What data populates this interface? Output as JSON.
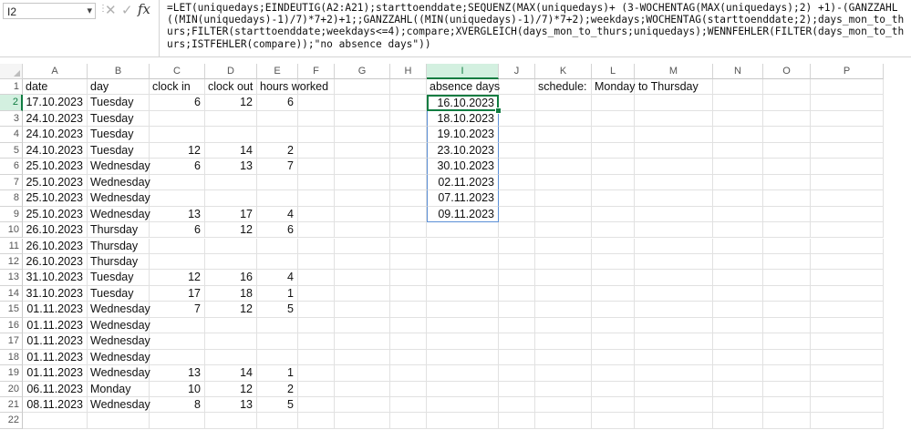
{
  "name_box": {
    "value": "I2",
    "dropdown_icon": "chevron-down-icon"
  },
  "formula_bar": {
    "cancel_icon": "x-icon",
    "enter_icon": "check-icon",
    "fx_label": "fx",
    "formula": "=LET(uniquedays;EINDEUTIG(A2:A21);starttoenddate;SEQUENZ(MAX(uniquedays)+ (3-WOCHENTAG(MAX(uniquedays);2) +1)-(GANZZAHL((MIN(uniquedays)-1)/7)*7+2)+1;;GANZZAHL((MIN(uniquedays)-1)/7)*7+2);weekdays;WOCHENTAG(starttoenddate;2);days_mon_to_thurs;FILTER(starttoenddate;weekdays<=4);compare;XVERGLEICH(days_mon_to_thurs;uniquedays);WENNFEHLER(FILTER(days_mon_to_thurs;ISTFEHLER(compare));\"no absence days\"))"
  },
  "columns": [
    "A",
    "B",
    "C",
    "D",
    "E",
    "F",
    "G",
    "H",
    "I",
    "J",
    "K",
    "L",
    "M",
    "N",
    "O",
    "P"
  ],
  "active_column": "I",
  "active_row": 2,
  "rows": [
    "1",
    "2",
    "3",
    "4",
    "5",
    "6",
    "7",
    "8",
    "9",
    "10",
    "11",
    "12",
    "13",
    "14",
    "15",
    "16",
    "17",
    "18",
    "19",
    "20",
    "21",
    "22"
  ],
  "headers": {
    "date": "date",
    "day": "day",
    "clock_in": "clock in",
    "clock_out": "clock out",
    "hours_worked": "hours worked",
    "absence_days": "absence days",
    "schedule": "schedule:",
    "schedule_value": "Monday to Thursday"
  },
  "data_rows": [
    {
      "date": "17.10.2023",
      "day": "Tuesday",
      "in": "6",
      "out": "12",
      "hours": "6"
    },
    {
      "date": "24.10.2023",
      "day": "Tuesday",
      "in": "",
      "out": "",
      "hours": ""
    },
    {
      "date": "24.10.2023",
      "day": "Tuesday",
      "in": "",
      "out": "",
      "hours": ""
    },
    {
      "date": "24.10.2023",
      "day": "Tuesday",
      "in": "12",
      "out": "14",
      "hours": "2"
    },
    {
      "date": "25.10.2023",
      "day": "Wednesday",
      "in": "6",
      "out": "13",
      "hours": "7"
    },
    {
      "date": "25.10.2023",
      "day": "Wednesday",
      "in": "",
      "out": "",
      "hours": ""
    },
    {
      "date": "25.10.2023",
      "day": "Wednesday",
      "in": "",
      "out": "",
      "hours": ""
    },
    {
      "date": "25.10.2023",
      "day": "Wednesday",
      "in": "13",
      "out": "17",
      "hours": "4"
    },
    {
      "date": "26.10.2023",
      "day": "Thursday",
      "in": "6",
      "out": "12",
      "hours": "6"
    },
    {
      "date": "26.10.2023",
      "day": "Thursday",
      "in": "",
      "out": "",
      "hours": ""
    },
    {
      "date": "26.10.2023",
      "day": "Thursday",
      "in": "",
      "out": "",
      "hours": ""
    },
    {
      "date": "31.10.2023",
      "day": "Tuesday",
      "in": "12",
      "out": "16",
      "hours": "4"
    },
    {
      "date": "31.10.2023",
      "day": "Tuesday",
      "in": "17",
      "out": "18",
      "hours": "1"
    },
    {
      "date": "01.11.2023",
      "day": "Wednesday",
      "in": "7",
      "out": "12",
      "hours": "5"
    },
    {
      "date": "01.11.2023",
      "day": "Wednesday",
      "in": "",
      "out": "",
      "hours": ""
    },
    {
      "date": "01.11.2023",
      "day": "Wednesday",
      "in": "",
      "out": "",
      "hours": ""
    },
    {
      "date": "01.11.2023",
      "day": "Wednesday",
      "in": "",
      "out": "",
      "hours": ""
    },
    {
      "date": "01.11.2023",
      "day": "Wednesday",
      "in": "13",
      "out": "14",
      "hours": "1"
    },
    {
      "date": "06.11.2023",
      "day": "Monday",
      "in": "10",
      "out": "12",
      "hours": "2"
    },
    {
      "date": "08.11.2023",
      "day": "Wednesday",
      "in": "8",
      "out": "13",
      "hours": "5"
    }
  ],
  "absence_days": [
    "16.10.2023",
    "18.10.2023",
    "19.10.2023",
    "23.10.2023",
    "30.10.2023",
    "02.11.2023",
    "07.11.2023",
    "09.11.2023"
  ],
  "colors": {
    "accent": "#107c41",
    "spill_border": "#5b8fd6",
    "gridline": "#e1e1e1"
  }
}
